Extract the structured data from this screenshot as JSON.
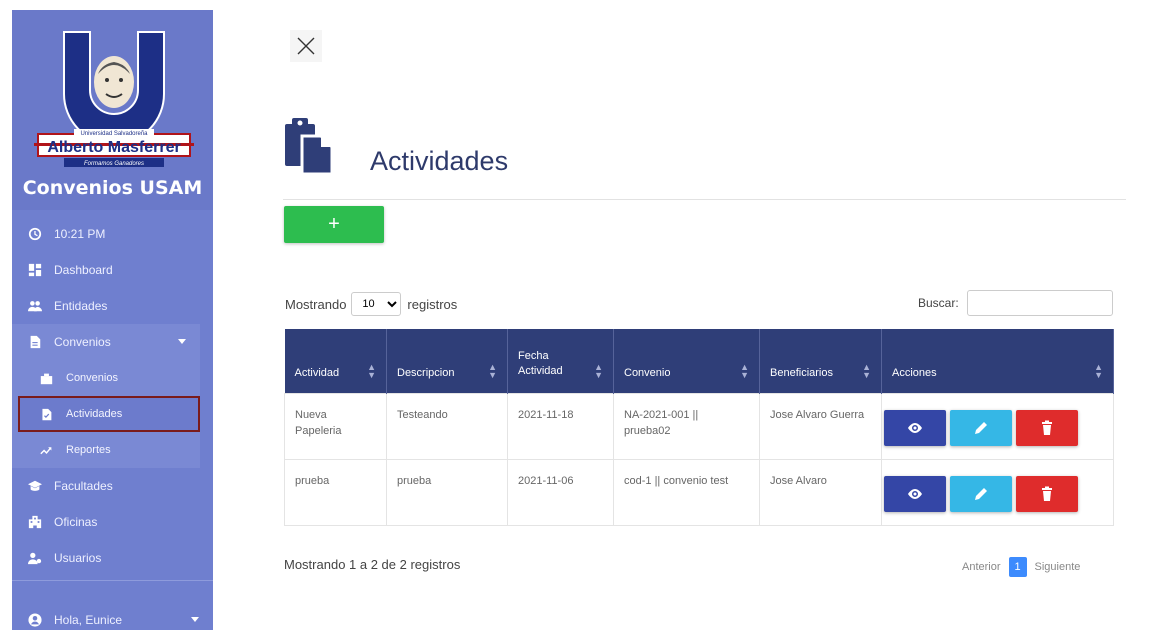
{
  "sidebar": {
    "brand": "Convenios USAM",
    "logo_text": {
      "top": "Universidad Salvadoreña",
      "name": "Alberto Masferrer",
      "motto": "Formamos Ganadores"
    },
    "items": [
      {
        "label": "10:21 PM",
        "icon": "clock-icon"
      },
      {
        "label": "Dashboard",
        "icon": "dashboard-icon"
      },
      {
        "label": "Entidades",
        "icon": "users-icon"
      },
      {
        "label": "Convenios",
        "icon": "file-icon"
      }
    ],
    "subitems": [
      {
        "label": "Convenios",
        "icon": "briefcase-icon"
      },
      {
        "label": "Actividades",
        "icon": "file-check-icon"
      },
      {
        "label": "Reportes",
        "icon": "trend-icon"
      }
    ],
    "items_after": [
      {
        "label": "Facultades",
        "icon": "graduation-cap-icon"
      },
      {
        "label": "Oficinas",
        "icon": "building-icon"
      },
      {
        "label": "Usuarios",
        "icon": "user-cog-icon"
      }
    ],
    "user": "Hola, Eunice"
  },
  "page": {
    "title": "Actividades",
    "add_label": "+"
  },
  "table_controls": {
    "show_prefix": "Mostrando",
    "show_value": "10",
    "show_suffix": "registros",
    "search_label": "Buscar:"
  },
  "table": {
    "columns": [
      "Actividad",
      "Descripcion",
      "Fecha Actividad",
      "Convenio",
      "Beneficiarios",
      "Acciones"
    ],
    "rows": [
      {
        "actividad": "Nueva Papeleria",
        "descripcion": "Testeando",
        "fecha": "2021-11-18",
        "convenio": "NA-2021-001 || prueba02",
        "beneficiarios": "Jose Alvaro Guerra"
      },
      {
        "actividad": "prueba",
        "descripcion": "prueba",
        "fecha": "2021-11-06",
        "convenio": "cod-1 || convenio test",
        "beneficiarios": "Jose Alvaro"
      }
    ]
  },
  "footer": {
    "info": "Mostrando 1 a 2 de 2 registros",
    "prev": "Anterior",
    "page": "1",
    "next": "Siguiente"
  },
  "colors": {
    "sidebar": "#6f7fcf",
    "header": "#2f3e78",
    "add": "#2dbd4f",
    "view": "#3446a6",
    "edit": "#35b7e6",
    "delete": "#df2c2c"
  }
}
